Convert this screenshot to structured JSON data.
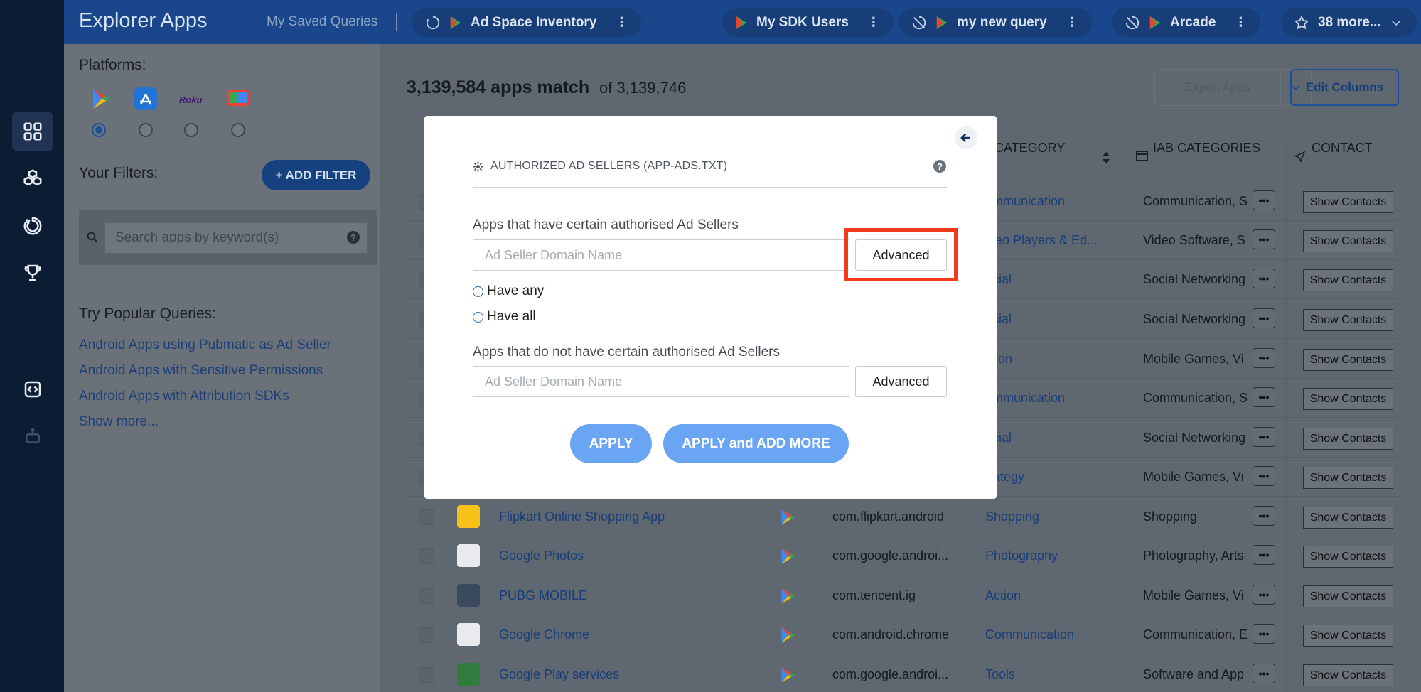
{
  "header": {
    "brand": "Explorer Apps",
    "saved_label": "My Saved Queries",
    "pills": [
      {
        "label": "Ad Space Inventory"
      },
      {
        "label": "My SDK Users"
      },
      {
        "label": "my new query"
      },
      {
        "label": "Arcade"
      },
      {
        "label": "38 more..."
      }
    ]
  },
  "sidebar": {
    "platforms_label": "Platforms:",
    "platforms": [
      "Google Play",
      "App Store",
      "Roku",
      "Smart TV"
    ],
    "selected_platform": "Google Play",
    "roku_text": "Roku",
    "filters_label": "Your Filters:",
    "add_filter": "+ ADD FILTER",
    "search_placeholder": "Search apps by keyword(s)",
    "popular_label": "Try Popular Queries:",
    "popular": [
      "Android Apps using Pubmatic as Ad Seller",
      "Android Apps with Sensitive Permissions",
      "Android Apps with Attribution SDKs",
      "Show more..."
    ]
  },
  "main": {
    "count": "3,139,584 apps match",
    "of_total": "of 3,139,746",
    "export_label": "Export Apps",
    "edit_columns": "Edit Columns",
    "columns": {
      "category": "CATEGORY",
      "iab": "IAB CATEGORIES",
      "contact": "CONTACT"
    },
    "show_contacts": "Show Contacts",
    "rows": [
      {
        "name": "",
        "package": "",
        "category": "ommunication",
        "iab": "Communication, S"
      },
      {
        "name": "",
        "package": "",
        "category": "ideo Players & Ed...",
        "iab": "Video Software, S"
      },
      {
        "name": "",
        "package": "",
        "category": "ocial",
        "iab": "Social Networking"
      },
      {
        "name": "",
        "package": "",
        "category": "ocial",
        "iab": "Social Networking"
      },
      {
        "name": "",
        "package": "",
        "category": "ction",
        "iab": "Mobile Games, Vi"
      },
      {
        "name": "",
        "package": "",
        "category": "ommunication",
        "iab": "Communication, S"
      },
      {
        "name": "",
        "package": "",
        "category": "ocial",
        "iab": "Social Networking"
      },
      {
        "name": "",
        "package": "",
        "category": "trategy",
        "iab": "Mobile Games, Vi"
      },
      {
        "name": "Flipkart Online Shopping App",
        "package": "com.flipkart.android",
        "category": "Shopping",
        "iab": "Shopping"
      },
      {
        "name": "Google Photos",
        "package": "com.google.androi...",
        "category": "Photography",
        "iab": "Photography, Arts"
      },
      {
        "name": "PUBG MOBILE",
        "package": "com.tencent.ig",
        "category": "Action",
        "iab": "Mobile Games, Vi"
      },
      {
        "name": "Google Chrome",
        "package": "com.android.chrome",
        "category": "Communication",
        "iab": "Communication, E"
      },
      {
        "name": "Google Play services",
        "package": "com.google.androi...",
        "category": "Tools",
        "iab": "Software and App"
      }
    ]
  },
  "modal": {
    "title": "AUTHORIZED AD SELLERS (APP-ADS.TXT)",
    "help": "?",
    "have_label": "Apps that have certain authorised Ad Sellers",
    "not_have_label": "Apps that do not have certain authorised Ad Sellers",
    "placeholder": "Ad Seller Domain Name",
    "advanced": "Advanced",
    "have_any": "Have any",
    "have_all": "Have all",
    "apply": "APPLY",
    "apply_more": "APPLY and ADD MORE"
  },
  "colors": {
    "highlight": "#f23a1a",
    "header": "#1a478c",
    "rail": "#0c1d33",
    "apply": "#6aa5f3"
  }
}
